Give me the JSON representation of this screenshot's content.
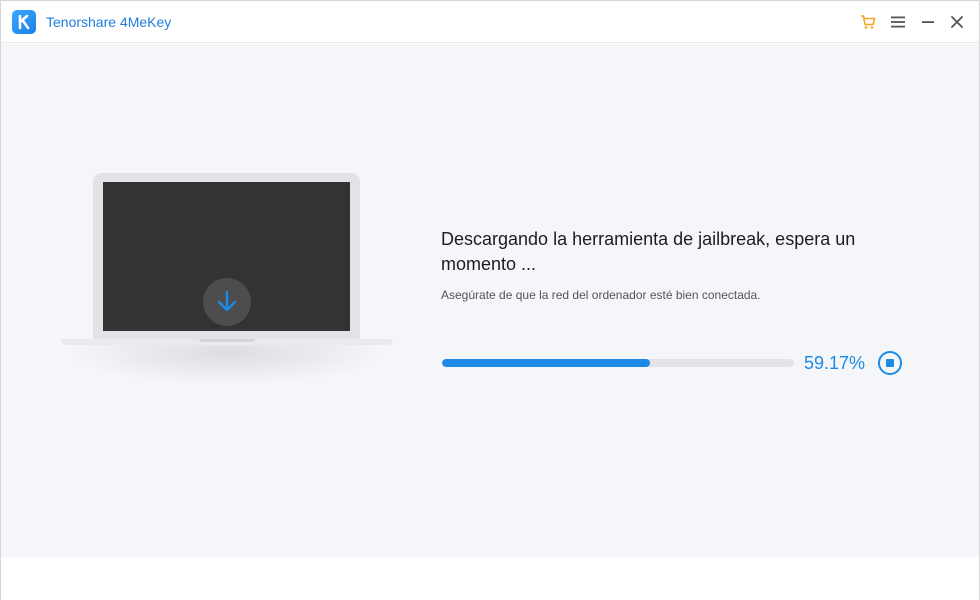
{
  "window": {
    "title": "Tenorshare 4MeKey",
    "controls": [
      {
        "name": "cart-icon",
        "icon": "shopping-cart",
        "color": "#f5a623"
      },
      {
        "name": "menu-icon",
        "icon": "hamburger-menu",
        "color": "#555555"
      },
      {
        "name": "minimize-icon",
        "icon": "minimize",
        "color": "#555555"
      },
      {
        "name": "close-icon",
        "icon": "close",
        "color": "#555555"
      }
    ]
  },
  "main": {
    "heading": "Descargando la herramienta de jailbreak, espera un momento ...",
    "subtext": "Asegúrate de que la red del ordenador esté bien conectada.",
    "progress": {
      "percent_label": "59.17%",
      "fraction": 0.5917
    },
    "illustration": {
      "device": "laptop",
      "center_icon": "download-arrow-icon"
    }
  },
  "colors": {
    "accent": "#1d8ae6",
    "title_text": "#1f7ee0",
    "content_bg": "#f5f6f9",
    "cart": "#f5a623"
  }
}
